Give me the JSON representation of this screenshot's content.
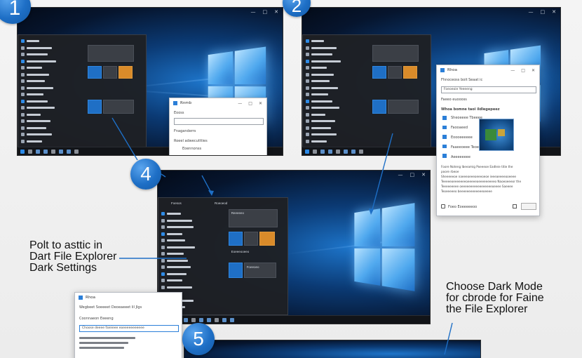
{
  "steps": {
    "s1": "1",
    "s2": "2",
    "s4": "4",
    "s5": "5"
  },
  "notes": {
    "left": [
      "Polt to asttic in",
      "Dart File Explorer",
      "Dark Settings"
    ],
    "right": [
      "Choose Dark Mode",
      "for cbrode for Faine",
      "the File Explorer"
    ]
  },
  "screen1": {
    "window_controls": [
      "—",
      "□",
      "✕"
    ],
    "dialog": {
      "title": "Rnmb",
      "heading": "Eooss",
      "field_label": "Fnaganderrs",
      "section": "Roeel adwecuttties",
      "item": "Eoennonss"
    }
  },
  "screen2": {
    "window_controls": [
      "—",
      "□",
      "✕"
    ],
    "dialog": {
      "title": "Rhoa",
      "heading": "Fhnoceoss boit Seaat ic",
      "search": "Foeoeoie Yeeeeng",
      "subheading": "Faeeo euoooss",
      "section": "Whoa bomne taoi ildlegepeez",
      "list": [
        "Sheoeeee Tbeeee",
        "Faooaeed",
        "Eoooeeeeee",
        "Faaeeoeee Teoee",
        "Aeeeeeeee"
      ],
      "paragraph": [
        "Foore Noteng lbeeamig Poeeeoe Eadleie titie the",
        "poore rbeoe",
        "Sheeeeeoe naeeeoeeeoeeeoeoe ieeeaeeeeooeeee",
        "Teeeeeoeeeeeeeoeeeeeoeeeeeeeeeo Naoeoeeeor the",
        "Teeeeeeeee oeeeeeeeeeeeeeeeeeoeeee Saeeee",
        "Teoeeeeeo beeeeeeeeeeeeeoeeee"
      ],
      "footer": "Foeo Eoeeeeeoo"
    }
  },
  "screen4": {
    "window_controls": [
      "—",
      "□",
      "✕"
    ],
    "menu_header": "Foesos",
    "tiles_header": "Roeoeod",
    "tile_labels": [
      "Reeeeeo",
      "Foeeoeo",
      "Eoeeeooeeo"
    ]
  },
  "screen_bottom": {
    "dialog": {
      "title": "Rhoa",
      "heading": "Wegbeet Soeeeet Deoeaeeet lil Jlgs",
      "field_label": "Coonnaeon Eeeeng",
      "search": "Choose deeee faieieee eoeeeeeeeeeee"
    }
  },
  "colors": {
    "accent": "#1e6fc6",
    "desktop": "#0b3a74",
    "startmenu": "#1e2024"
  }
}
